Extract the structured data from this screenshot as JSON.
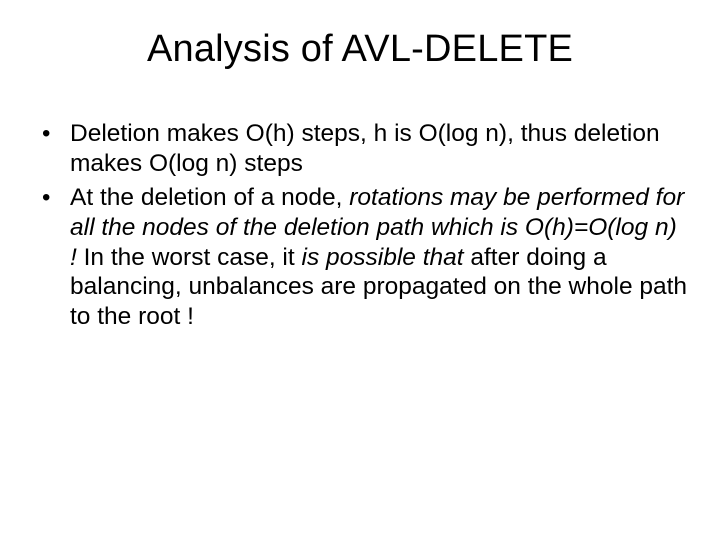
{
  "slide": {
    "title": "Analysis of AVL-DELETE",
    "bullets": [
      {
        "plain1": "Deletion makes O(h)  steps, h is O(log n), thus deletion makes O(log n) steps"
      },
      {
        "plain1": "At the deletion of a node,  ",
        "ital1": "rotations may be performed  for all the nodes of the deletion path which is O(h)=O(log n) ! ",
        "plain2": "In the worst case, it ",
        "ital2": "is possible that ",
        "plain3": "after doing a balancing, unbalances are propagated on the whole path to the root !"
      }
    ]
  }
}
